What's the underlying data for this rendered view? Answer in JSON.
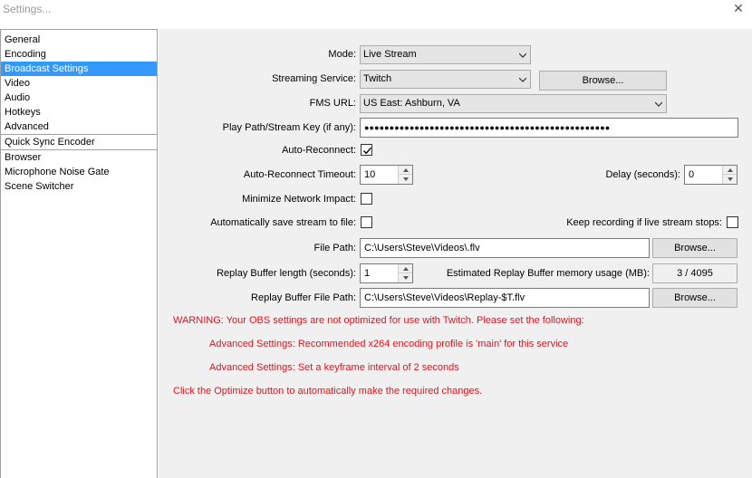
{
  "window": {
    "title": "Settings...",
    "close_glyph": "✕"
  },
  "sidebar": {
    "items": [
      {
        "label": "General",
        "selected": false
      },
      {
        "label": "Encoding",
        "selected": false
      },
      {
        "label": "Broadcast Settings",
        "selected": true
      },
      {
        "label": "Video",
        "selected": false
      },
      {
        "label": "Audio",
        "selected": false
      },
      {
        "label": "Hotkeys",
        "selected": false
      },
      {
        "label": "Advanced",
        "selected": false
      },
      {
        "label": "Quick Sync Encoder",
        "selected": false
      },
      {
        "label": "Browser",
        "selected": false
      },
      {
        "label": "Microphone Noise Gate",
        "selected": false
      },
      {
        "label": "Scene Switcher",
        "selected": false
      }
    ]
  },
  "form": {
    "mode": {
      "label": "Mode:",
      "value": "Live Stream"
    },
    "service": {
      "label": "Streaming Service:",
      "value": "Twitch",
      "browse": "Browse..."
    },
    "fms": {
      "label": "FMS URL:",
      "value": "US East: Ashburn, VA"
    },
    "stream_key": {
      "label": "Play Path/Stream Key (if any):",
      "value": "●●●●●●●●●●●●●●●●●●●●●●●●●●●●●●●●●●●●●●●●●●●●●●●●●"
    },
    "auto_reconnect": {
      "label": "Auto-Reconnect:",
      "checked": true
    },
    "reconnect_timeout": {
      "label": "Auto-Reconnect Timeout:",
      "value": "10"
    },
    "delay": {
      "label": "Delay (seconds):",
      "value": "0"
    },
    "min_impact": {
      "label": "Minimize Network Impact:",
      "checked": false
    },
    "auto_save": {
      "label": "Automatically save stream to file:",
      "checked": false
    },
    "keep_recording": {
      "label": "Keep recording if live stream stops:",
      "checked": false
    },
    "file_path": {
      "label": "File Path:",
      "value": "C:\\Users\\Steve\\Videos\\.flv",
      "browse": "Browse..."
    },
    "replay_len": {
      "label": "Replay Buffer length (seconds):",
      "value": "1"
    },
    "replay_mem": {
      "label": "Estimated Replay Buffer memory usage (MB):",
      "value": "3 / 4095"
    },
    "replay_path": {
      "label": "Replay Buffer File Path:",
      "value": "C:\\Users\\Steve\\Videos\\Replay-$T.flv",
      "browse": "Browse..."
    }
  },
  "warnings": {
    "line1": "WARNING: Your OBS settings are not optimized for use with Twitch. Please set the following:",
    "line2": "Advanced Settings: Recommended x264 encoding profile is 'main' for this service",
    "line3": "Advanced Settings: Set a keyframe interval of 2 seconds",
    "line4": "Click the Optimize button to automatically make the required changes.",
    "color": "#e0141e"
  },
  "colors": {
    "selection": "#3399ff",
    "panel": "#f0f0f0"
  }
}
